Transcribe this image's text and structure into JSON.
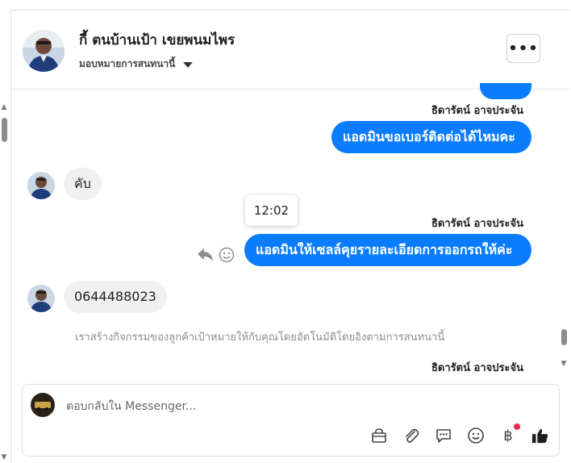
{
  "header": {
    "title": "กี้ ตนบ้านเป้า เขยพนมไพร",
    "assign_label": "มอบหมายการสนทนานี้",
    "more_label": "•••"
  },
  "messages": {
    "sender_1": "ธิดารัตน์ อาจประจัน",
    "out_1": "แอดมินขอเบอร์ติดต่อได้ไหมคะ",
    "in_1": "คับ",
    "tooltip_time": "12:02",
    "sender_2": "ธิดารัตน์ อาจประจัน",
    "out_2": "แอดมินให้เซลล์คุยรายละเอียดการออกรถให้ค่ะ",
    "in_2": "0644488023",
    "system_note": "เราสร้างกิจกรรมของลูกค้าเป้าหมายให้กับคุณโดยอัตโนมัติโดยอิงตามการสนทนานี้",
    "sender_3": "ธิดารัตน์ อาจประจัน"
  },
  "composer": {
    "placeholder": "ตอบกลับใน Messenger...",
    "tools": [
      "bag-icon",
      "attachment-icon",
      "saved-reply-icon",
      "emoji-icon",
      "baht-icon",
      "like-icon"
    ]
  },
  "colors": {
    "outgoing_bubble": "#0a7cff",
    "incoming_bubble": "#f0f0f0",
    "notification_dot": "#f02849"
  }
}
